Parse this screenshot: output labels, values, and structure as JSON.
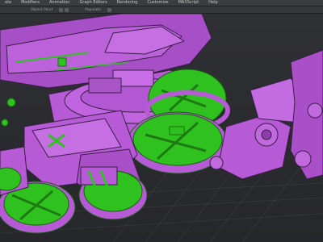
{
  "menubar": {
    "items": [
      "ate",
      "Modifiers",
      "Animation",
      "Graph Editors",
      "Rendering",
      "Customize",
      "MAXScript",
      "Help"
    ]
  },
  "toolbar": {
    "object_paint_label": "Object Paint",
    "populate_label": "Populate"
  },
  "colors": {
    "model": "#b75ad9",
    "accent": "#2fc21f",
    "background": "#2e2f33"
  }
}
